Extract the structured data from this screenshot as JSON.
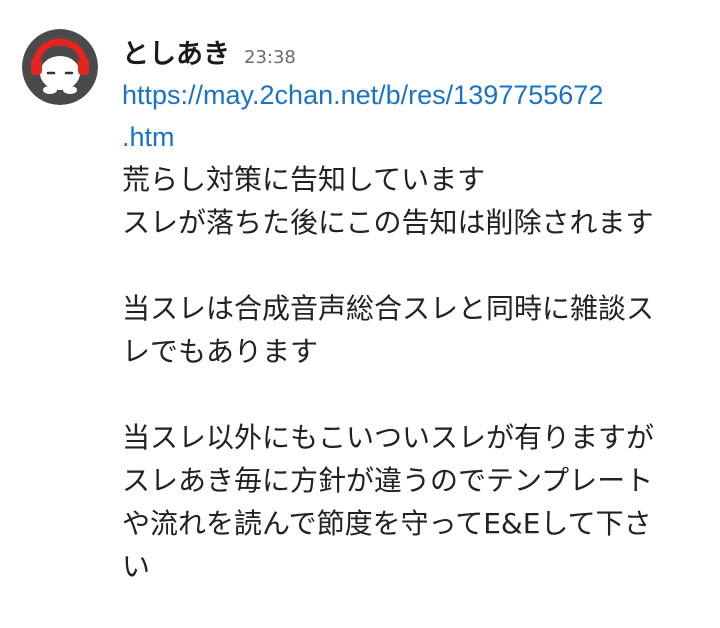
{
  "message": {
    "author": "としあき",
    "timestamp": "23:38",
    "link_line1": "https://may.2chan.net/b/res/1397755672",
    "link_line2": ".htm",
    "lines": [
      "荒らし対策に告知しています",
      "スレが落ちた後にこの告知は削除されます",
      "",
      "当スレは合成音声総合スレと同時に雑談ス",
      "レでもあります",
      "",
      "当スレ以外にもこいついスレが有りますが",
      "スレあき毎に方針が違うのでテンプレート",
      "や流れを読んで節度を守ってE&Eして下さ",
      "い"
    ]
  },
  "avatar": {
    "icon": "headphones-character-avatar",
    "background_color": "#4a4a4a",
    "accent_color": "#e52420"
  },
  "colors": {
    "link": "#1a73c8",
    "text": "#222222",
    "timestamp": "#6b6b6b"
  }
}
